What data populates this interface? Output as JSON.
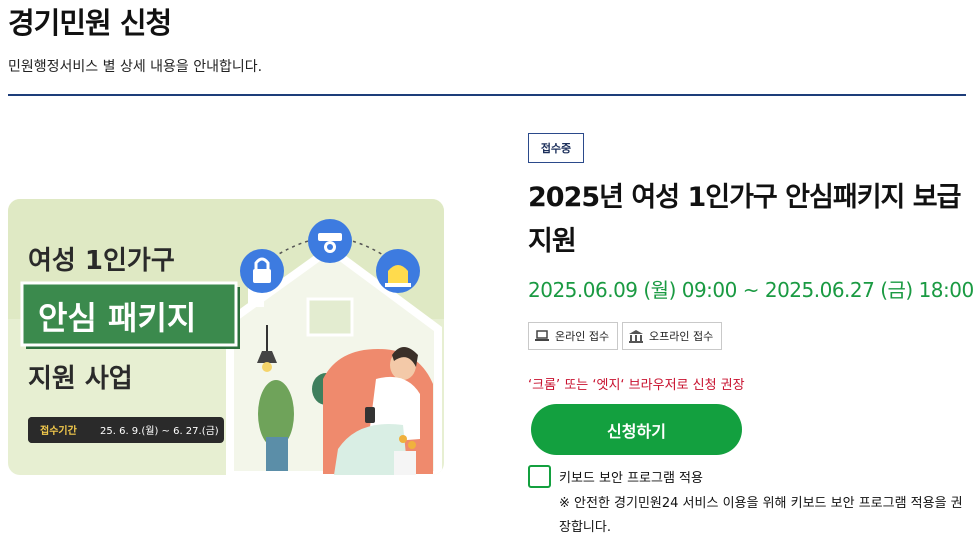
{
  "header": {
    "title": "경기민원 신청",
    "description": "민원행정서비스 별 상세 내용을 안내합니다."
  },
  "banner": {
    "line1": "여성 1인가구",
    "highlight": "안심 패키지",
    "line3": "지원 사업",
    "period_label": "접수기간",
    "period_text": "25. 6. 9.(월) ~ 6. 27.(금)",
    "icons": [
      "lock-icon",
      "cctv-icon",
      "siren-icon"
    ],
    "colors": {
      "bg": "#e9f0d3",
      "accent": "#3b8a4d",
      "icon": "#3d7be0",
      "dark": "#2a2a2a"
    }
  },
  "detail": {
    "status": "접수중",
    "title": "2025년 여성 1인가구 안심패키지 보급 지원",
    "period": "2025.06.09 (월) 09:00 ~ 2025.06.27 (금) 18:00",
    "channels": [
      {
        "label": "온라인 접수",
        "icon": "laptop-icon"
      },
      {
        "label": "오프라인 접수",
        "icon": "building-icon"
      }
    ],
    "browser_note": "‘크롬’ 또는 ‘엣지‘ 브라우저로 신청 권장",
    "apply_label": "신청하기",
    "keyboard_label": "키보드 보안 프로그램 적용",
    "keyboard_checked": false,
    "keyboard_note": "※ 안전한 경기민원24 서비스 이용을 위해 키보드 보안 프로그램 적용을 권장합니다."
  },
  "colors": {
    "accent_green": "#13a03f",
    "navy": "#1d3d7a",
    "warning_red": "#c8102e"
  }
}
